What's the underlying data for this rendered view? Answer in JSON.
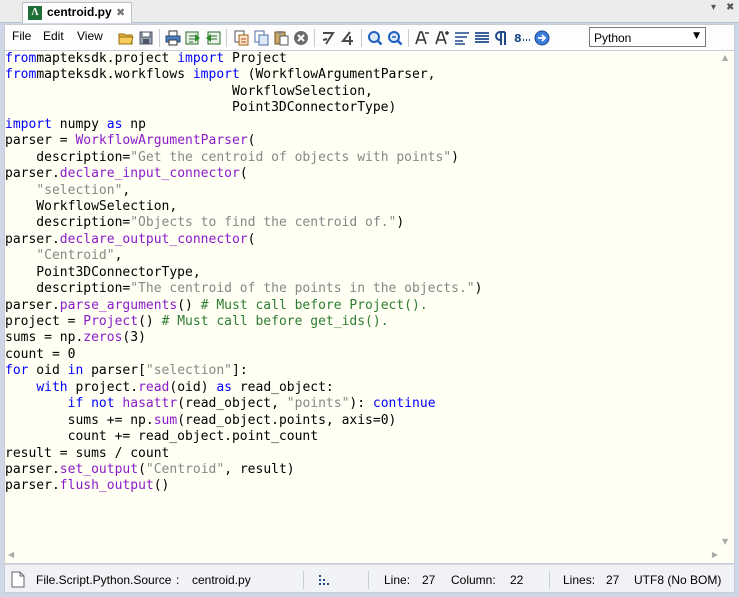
{
  "tab": {
    "icon_glyph": "Λ",
    "title": "centroid.py",
    "close": "✖"
  },
  "window_controls": {
    "dropdown": "▾",
    "close": "✖"
  },
  "menu": {
    "file": "File",
    "edit": "Edit",
    "view": "View"
  },
  "toolbar_icons": [
    "open-folder-icon",
    "save-icon",
    "print-icon",
    "export-icon",
    "import-icon",
    "cut-icon",
    "copy-icon",
    "paste-icon",
    "clear-icon",
    "undo-icon",
    "redo-icon",
    "find-icon",
    "find-next-icon",
    "decrease-font-icon",
    "increase-font-icon",
    "word-wrap-icon",
    "align-icon",
    "pilcrow-icon",
    "line-numbers-icon",
    "goto-icon"
  ],
  "language": {
    "selected": "Python"
  },
  "code_lines": [
    [
      [
        "kw",
        "from"
      ],
      [
        "",
        "mapteksdk.project "
      ],
      [
        "kw",
        "import"
      ],
      [
        "",
        " Project"
      ]
    ],
    [
      [
        "kw",
        "from"
      ],
      [
        "",
        "mapteksdk.workflows "
      ],
      [
        "kw",
        "import"
      ],
      [
        "",
        " (WorkflowArgumentParser,"
      ]
    ],
    [
      [
        "",
        "                             WorkflowSelection,"
      ]
    ],
    [
      [
        "",
        "                             Point3DConnectorType)"
      ]
    ],
    [
      [
        "kw",
        "import"
      ],
      [
        "",
        " numpy "
      ],
      [
        "kw",
        "as"
      ],
      [
        "",
        " np"
      ]
    ],
    [
      [
        "",
        "parser = "
      ],
      [
        "fn",
        "WorkflowArgumentParser"
      ],
      [
        "",
        "("
      ]
    ],
    [
      [
        "",
        "    description="
      ],
      [
        "str",
        "\"Get the centroid of objects with points\""
      ],
      [
        "",
        ")"
      ]
    ],
    [
      [
        "",
        "parser."
      ],
      [
        "fn",
        "declare_input_connector"
      ],
      [
        "",
        "("
      ]
    ],
    [
      [
        "",
        "    "
      ],
      [
        "str",
        "\"selection\""
      ],
      [
        "",
        ","
      ]
    ],
    [
      [
        "",
        "    WorkflowSelection,"
      ]
    ],
    [
      [
        "",
        "    description="
      ],
      [
        "str",
        "\"Objects to find the centroid of.\""
      ],
      [
        "",
        ")"
      ]
    ],
    [
      [
        "",
        "parser."
      ],
      [
        "fn",
        "declare_output_connector"
      ],
      [
        "",
        "("
      ]
    ],
    [
      [
        "",
        "    "
      ],
      [
        "str",
        "\"Centroid\""
      ],
      [
        "",
        ","
      ]
    ],
    [
      [
        "",
        "    Point3DConnectorType,"
      ]
    ],
    [
      [
        "",
        "    description="
      ],
      [
        "str",
        "\"The centroid of the points in the objects.\""
      ],
      [
        "",
        ")"
      ]
    ],
    [
      [
        "",
        "parser."
      ],
      [
        "fn",
        "parse_arguments"
      ],
      [
        "",
        "() "
      ],
      [
        "cm",
        "# Must call before Project()."
      ]
    ],
    [
      [
        "",
        "project = "
      ],
      [
        "fn",
        "Project"
      ],
      [
        "",
        "() "
      ],
      [
        "cm",
        "# Must call before get_ids()."
      ]
    ],
    [
      [
        "",
        "sums = np."
      ],
      [
        "fn",
        "zeros"
      ],
      [
        "",
        "(3)"
      ]
    ],
    [
      [
        "",
        "count = 0"
      ]
    ],
    [
      [
        "kw",
        "for"
      ],
      [
        "",
        " oid "
      ],
      [
        "kw",
        "in"
      ],
      [
        "",
        " parser["
      ],
      [
        "str",
        "\"selection\""
      ],
      [
        "",
        "]:"
      ]
    ],
    [
      [
        "",
        "    "
      ],
      [
        "kw",
        "with"
      ],
      [
        "",
        " project."
      ],
      [
        "fn",
        "read"
      ],
      [
        "",
        "(oid) "
      ],
      [
        "kw",
        "as"
      ],
      [
        "",
        " read_object:"
      ]
    ],
    [
      [
        "",
        "        "
      ],
      [
        "kw",
        "if not"
      ],
      [
        "",
        " "
      ],
      [
        "fn",
        "hasattr"
      ],
      [
        "",
        "(read_object, "
      ],
      [
        "str",
        "\"points\""
      ],
      [
        "",
        "): "
      ],
      [
        "kw",
        "continue"
      ]
    ],
    [
      [
        "",
        "        sums += np."
      ],
      [
        "fn",
        "sum"
      ],
      [
        "",
        "(read_object.points, axis=0)"
      ]
    ],
    [
      [
        "",
        "        count += read_object.point_count"
      ]
    ],
    [
      [
        "",
        "result = sums / count"
      ]
    ],
    [
      [
        "",
        "parser."
      ],
      [
        "fn",
        "set_output"
      ],
      [
        "",
        "("
      ],
      [
        "str",
        "\"Centroid\""
      ],
      [
        "",
        ", result)"
      ]
    ],
    [
      [
        "",
        "parser."
      ],
      [
        "fn",
        "flush_output"
      ],
      [
        "",
        "()"
      ]
    ]
  ],
  "status": {
    "script_type": "File.Script.Python.Source",
    "colon": ":",
    "file_name": "centroid.py",
    "line_label": "Line:",
    "line_value": "27",
    "column_label": "Column:",
    "column_value": "22",
    "lines_label": "Lines:",
    "lines_value": "27",
    "encoding": "UTF8 (No BOM)"
  }
}
